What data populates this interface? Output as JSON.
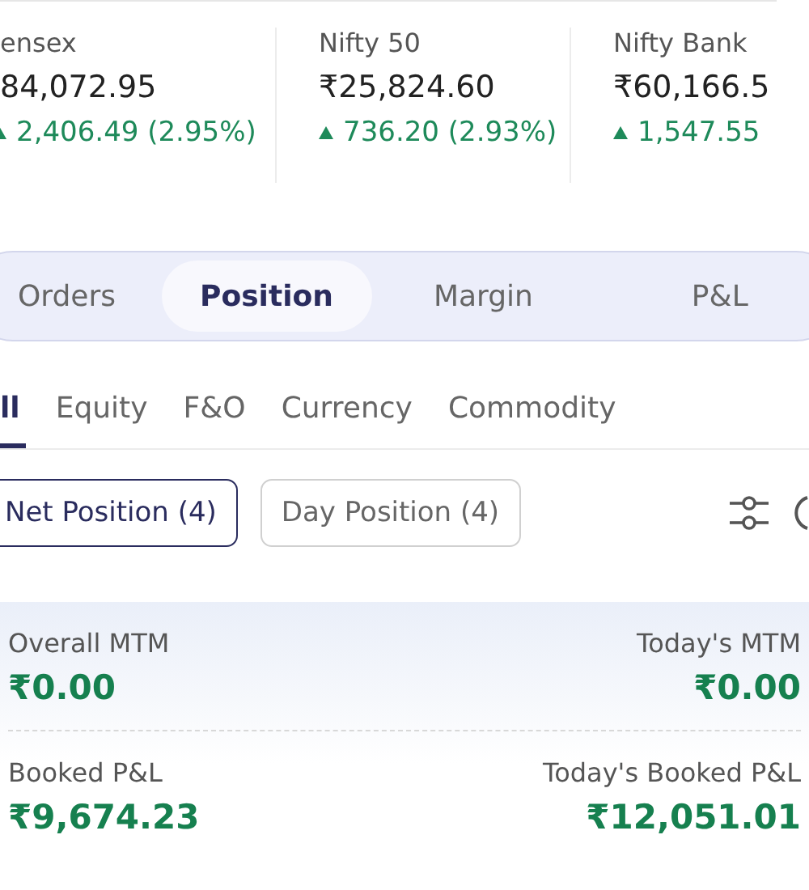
{
  "indices": [
    {
      "name": "ensex",
      "value": "84,072.95",
      "change": "2,406.49 (2.95%)",
      "up": true
    },
    {
      "name": "Nifty 50",
      "value": "₹25,824.60",
      "change": "736.20 (2.93%)",
      "up": true
    },
    {
      "name": "Nifty Bank",
      "value": "₹60,166.5",
      "change": "1,547.55",
      "up": true
    }
  ],
  "segments": [
    {
      "label": "Orders",
      "selected": false
    },
    {
      "label": "Position",
      "selected": true
    },
    {
      "label": "Margin",
      "selected": false
    },
    {
      "label": "P&L",
      "selected": false
    }
  ],
  "tabs": [
    {
      "label": "ll",
      "selected": true
    },
    {
      "label": "Equity",
      "selected": false
    },
    {
      "label": "F&O",
      "selected": false
    },
    {
      "label": "Currency",
      "selected": false
    },
    {
      "label": "Commodity",
      "selected": false
    }
  ],
  "chips": [
    {
      "label": "Net Position (4)",
      "selected": true
    },
    {
      "label": "Day Position (4)",
      "selected": false
    }
  ],
  "summary": [
    {
      "label": "Overall MTM",
      "value": "₹0.00"
    },
    {
      "label": "Today's MTM",
      "value": "₹0.00"
    },
    {
      "label": "Booked P&L",
      "value": "₹9,674.23"
    },
    {
      "label": "Today's Booked P&L",
      "value": "₹12,051.01"
    }
  ]
}
